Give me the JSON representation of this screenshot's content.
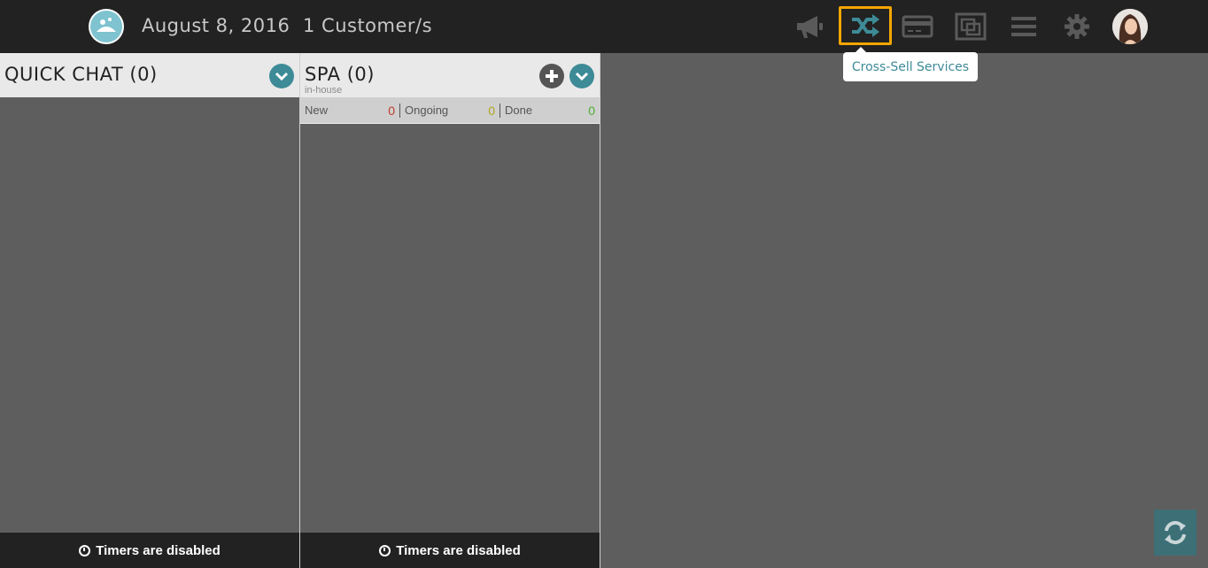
{
  "header": {
    "date": "August 8, 2016",
    "customers": "1 Customer/s",
    "icons": [
      "megaphone-icon",
      "shuffle-icon",
      "credit-card-icon",
      "layers-icon",
      "menu-icon",
      "gear-icon",
      "avatar"
    ],
    "accent": "#3d8b97",
    "active_border": "#f3a600"
  },
  "tooltip": {
    "text": "Cross-Sell Services"
  },
  "columns": {
    "quick_chat": {
      "title": "QUICK CHAT (0)",
      "footer": "Timers are disabled"
    },
    "spa": {
      "title": "SPA (0)",
      "subtitle": "in-house",
      "stats": [
        {
          "label": "New",
          "value": "0",
          "color": "#c0392b"
        },
        {
          "label": "Ongoing",
          "value": "0",
          "color": "#b3a51f"
        },
        {
          "label": "Done",
          "value": "0",
          "color": "#4caf30"
        }
      ],
      "footer": "Timers are disabled"
    }
  }
}
